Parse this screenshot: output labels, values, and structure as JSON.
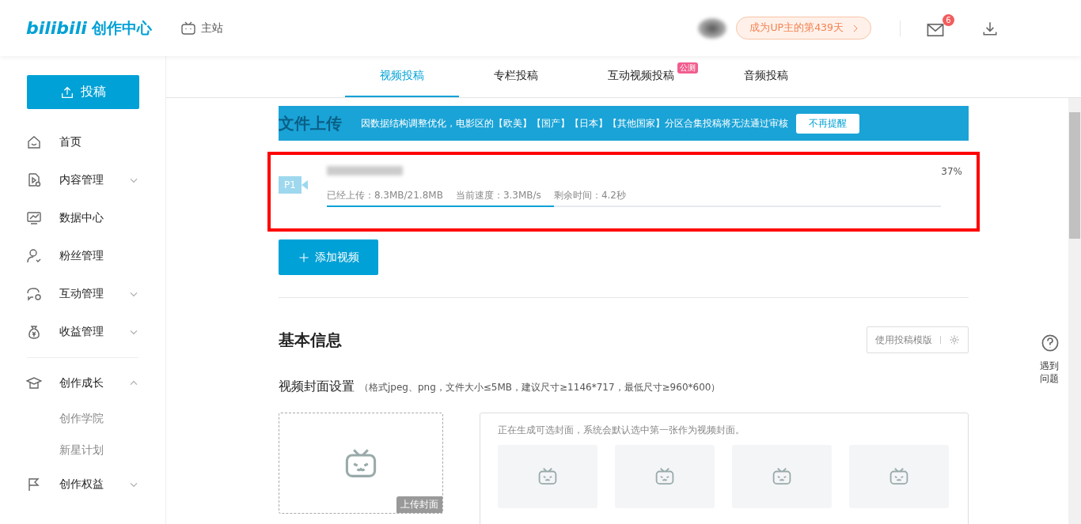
{
  "header": {
    "logo": "bilibili",
    "logo_suffix": "创作中心",
    "home_link": "主站",
    "badge": "成为UP主的第439天",
    "message_count": "6"
  },
  "sidebar": {
    "upload_button": "投稿",
    "items": [
      {
        "label": "首页"
      },
      {
        "label": "内容管理",
        "expanded": false
      },
      {
        "label": "数据中心"
      },
      {
        "label": "粉丝管理"
      },
      {
        "label": "互动管理",
        "expanded": false
      },
      {
        "label": "收益管理",
        "expanded": false
      },
      {
        "label": "创作成长",
        "expanded": true,
        "children": [
          {
            "label": "创作学院"
          },
          {
            "label": "新星计划"
          }
        ]
      },
      {
        "label": "创作权益",
        "expanded": false
      }
    ]
  },
  "tabs": [
    {
      "label": "视频投稿",
      "selected": true
    },
    {
      "label": "专栏投稿",
      "selected": false
    },
    {
      "label": "互动视频投稿",
      "selected": false,
      "tag": "公测"
    },
    {
      "label": "音频投稿",
      "selected": false
    }
  ],
  "upload": {
    "title": "文件上传",
    "notice": "因数据结构调整优化，电影区的【欧美】【国产】【日本】【其他国家】分区合集投稿将无法通过审核",
    "notice_button": "不再提醒",
    "file": {
      "part": "P1",
      "percent": "37%",
      "uploaded": "已经上传：8.3MB/21.8MB",
      "speed": "当前速度：3.3MB/s",
      "remaining": "剩余时间：4.2秒",
      "level": 0.37
    },
    "add_button": "添加视频"
  },
  "basic": {
    "title": "基本信息",
    "template_button": "使用投稿模版",
    "cover_label": "视频封面设置",
    "cover_hint": "（格式jpeg、png，文件大小≤5MB，建议尺寸≥1146*717，最低尺寸≥960*600）",
    "cover_upload": "上传封面",
    "generating": "正在生成可选封面，系统会默认选中第一张作为视频封面。"
  },
  "help": "遇到问题"
}
